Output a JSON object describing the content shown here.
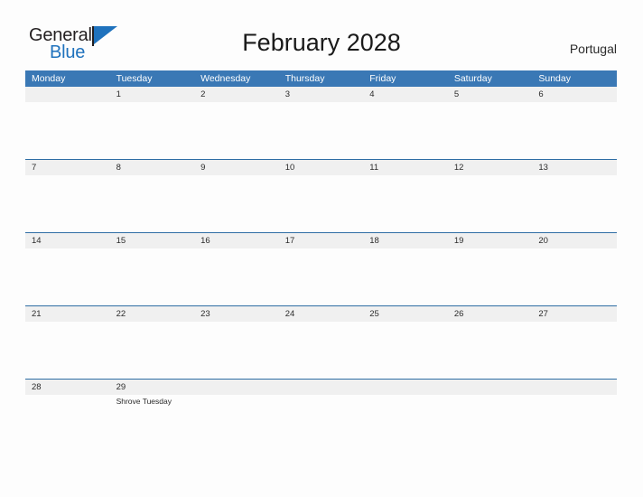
{
  "brand": {
    "name_part1": "General",
    "name_part2": "Blue",
    "flag_icon": "blue-triangle-flag-icon",
    "accent_color": "#1f72bd"
  },
  "header": {
    "title": "February 2028",
    "country": "Portugal"
  },
  "colors": {
    "header_band": "#3a78b5",
    "date_band": "#f0f0f0",
    "divider": "#2e6da4",
    "page_background": "#fdfdfd",
    "text": "#2b2b2b"
  },
  "calendar": {
    "weekdays": [
      "Monday",
      "Tuesday",
      "Wednesday",
      "Thursday",
      "Friday",
      "Saturday",
      "Sunday"
    ],
    "weeks": [
      {
        "divider_above": false,
        "days": [
          {
            "number": "",
            "events": []
          },
          {
            "number": "1",
            "events": []
          },
          {
            "number": "2",
            "events": []
          },
          {
            "number": "3",
            "events": []
          },
          {
            "number": "4",
            "events": []
          },
          {
            "number": "5",
            "events": []
          },
          {
            "number": "6",
            "events": []
          }
        ]
      },
      {
        "divider_above": true,
        "days": [
          {
            "number": "7",
            "events": []
          },
          {
            "number": "8",
            "events": []
          },
          {
            "number": "9",
            "events": []
          },
          {
            "number": "10",
            "events": []
          },
          {
            "number": "11",
            "events": []
          },
          {
            "number": "12",
            "events": []
          },
          {
            "number": "13",
            "events": []
          }
        ]
      },
      {
        "divider_above": true,
        "days": [
          {
            "number": "14",
            "events": []
          },
          {
            "number": "15",
            "events": []
          },
          {
            "number": "16",
            "events": []
          },
          {
            "number": "17",
            "events": []
          },
          {
            "number": "18",
            "events": []
          },
          {
            "number": "19",
            "events": []
          },
          {
            "number": "20",
            "events": []
          }
        ]
      },
      {
        "divider_above": true,
        "days": [
          {
            "number": "21",
            "events": []
          },
          {
            "number": "22",
            "events": []
          },
          {
            "number": "23",
            "events": []
          },
          {
            "number": "24",
            "events": []
          },
          {
            "number": "25",
            "events": []
          },
          {
            "number": "26",
            "events": []
          },
          {
            "number": "27",
            "events": []
          }
        ]
      },
      {
        "divider_above": true,
        "days": [
          {
            "number": "28",
            "events": []
          },
          {
            "number": "29",
            "events": [
              "Shrove Tuesday"
            ]
          },
          {
            "number": "",
            "events": []
          },
          {
            "number": "",
            "events": []
          },
          {
            "number": "",
            "events": []
          },
          {
            "number": "",
            "events": []
          },
          {
            "number": "",
            "events": []
          }
        ]
      }
    ]
  }
}
